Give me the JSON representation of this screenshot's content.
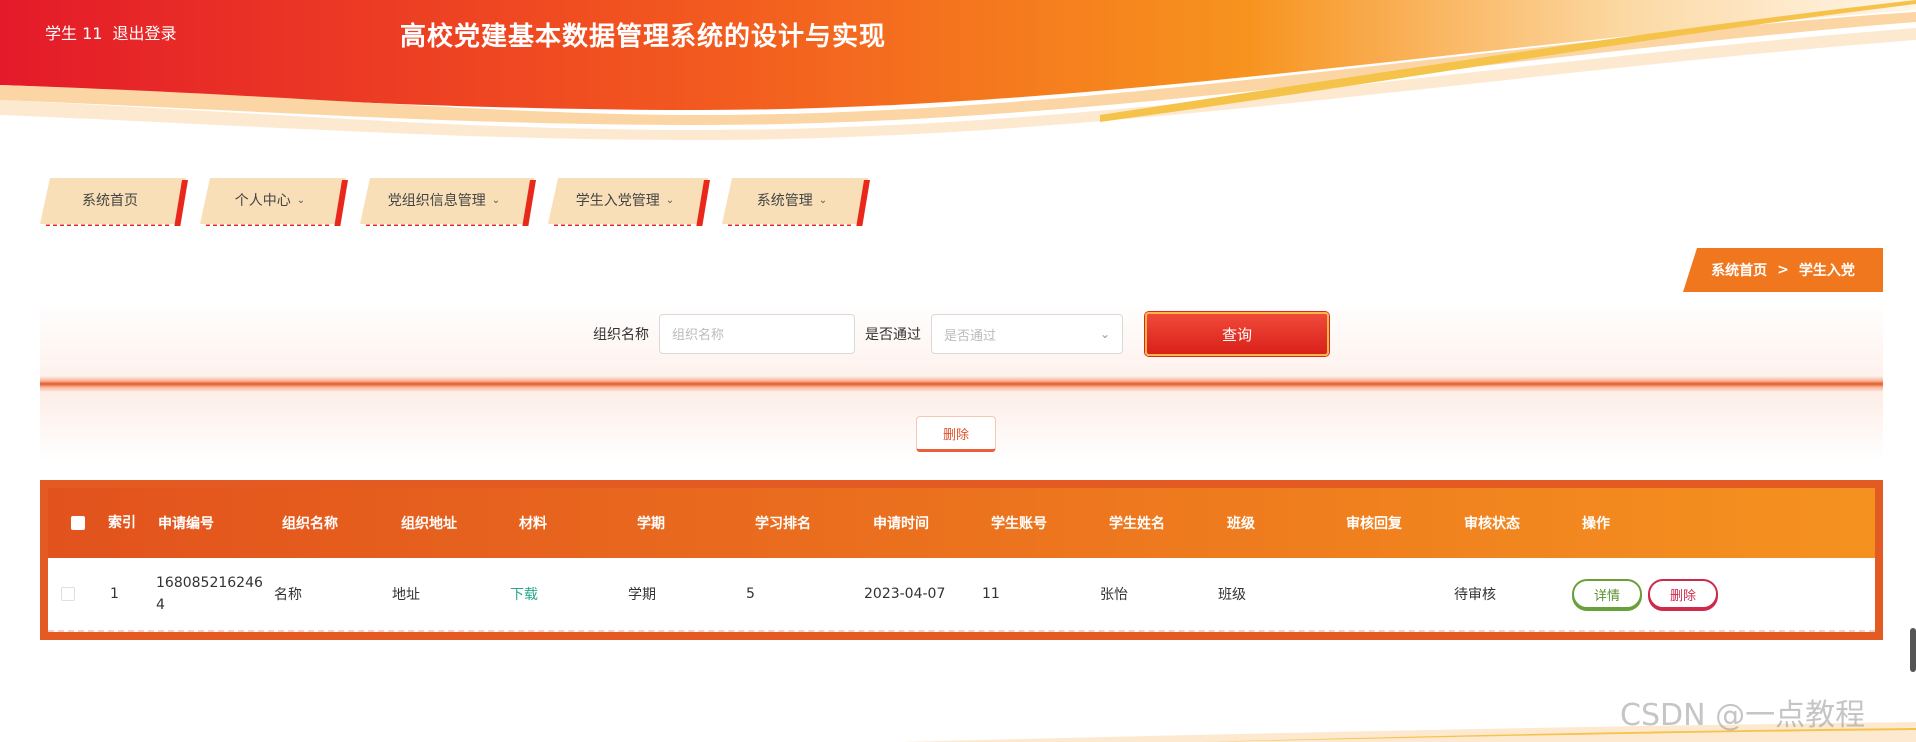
{
  "header": {
    "user_label": "学生 11",
    "logout_label": "退出登录",
    "site_title": "高校党建基本数据管理系统的设计与实现"
  },
  "nav": {
    "items": [
      {
        "label": "系统首页"
      },
      {
        "label": "个人中心"
      },
      {
        "label": "党组织信息管理"
      },
      {
        "label": "学生入党管理"
      },
      {
        "label": "系统管理"
      }
    ]
  },
  "breadcrumb": {
    "home": "系统首页",
    "separator": ">",
    "current": "学生入党"
  },
  "search": {
    "org_name_label": "组织名称",
    "org_name_placeholder": "组织名称",
    "passed_label": "是否通过",
    "passed_placeholder": "是否通过",
    "query_label": "查询"
  },
  "actions": {
    "delete_label": "删除"
  },
  "table": {
    "headers": [
      "索引",
      "申请编号",
      "组织名称",
      "组织地址",
      "材料",
      "学期",
      "学习排名",
      "申请时间",
      "学生账号",
      "学生姓名",
      "班级",
      "审核回复",
      "审核状态",
      "操作"
    ],
    "rows": [
      {
        "index": "1",
        "apply_no_line1": "168085216246",
        "apply_no_line2": "4",
        "org_name": "名称",
        "org_address": "地址",
        "material": "下载",
        "term": "学期",
        "rank": "5",
        "apply_time": "2023-04-07",
        "student_account": "11",
        "student_name": "张怡",
        "class": "班级",
        "review_reply": "",
        "review_status": "待审核",
        "detail_label": "详情",
        "delete_label": "删除"
      }
    ]
  },
  "watermark": "CSDN @一点教程",
  "colors": {
    "primary": "#e35a22",
    "accent_red": "#d9201a",
    "header_gold": "#f5c24a",
    "nav_tab_bg": "#f8dfb8"
  },
  "icons": {
    "chevron": "chevron-down-icon"
  }
}
